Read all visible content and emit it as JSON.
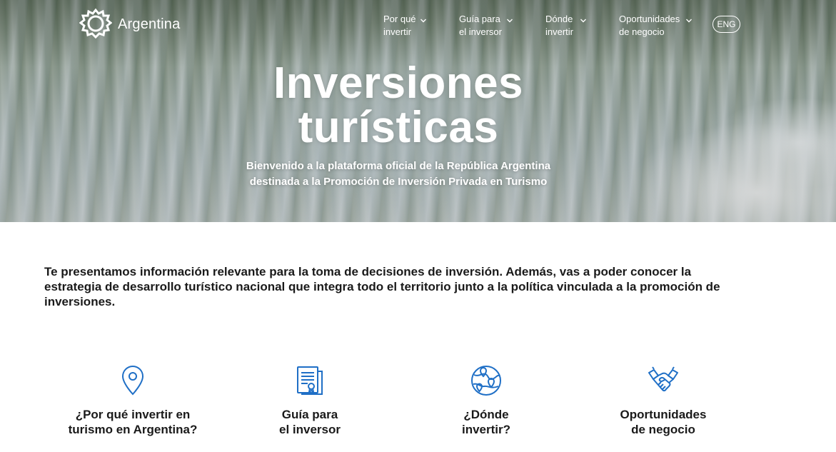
{
  "header": {
    "logo_text": "Argentina",
    "logo_icon": "sun-emblem-icon",
    "nav": [
      {
        "line1": "Por qué",
        "line2": "invertir"
      },
      {
        "line1": "Guía para",
        "line2": "el inversor"
      },
      {
        "line1": "Dónde",
        "line2": "invertir"
      },
      {
        "line1": "Oportunidades",
        "line2": "de negocio"
      }
    ],
    "lang_label": "ENG"
  },
  "hero": {
    "title_line1": "Inversiones",
    "title_line2": "turísticas",
    "subtitle_line1": "Bienvenido a la plataforma oficial de la República Argentina",
    "subtitle_line2": "destinada a la Promoción de Inversión Privada en Turismo"
  },
  "intro": {
    "text": "Te presentamos información relevante para la toma de decisiones de inversión. Además, vas a poder conocer la estrategia de desarrollo turístico nacional que integra todo el territorio junto a la política vinculada a la promoción de inversiones."
  },
  "cards": [
    {
      "icon": "map-pin-icon",
      "line1": "¿Por qué invertir en",
      "line2": "turismo en Argentina?"
    },
    {
      "icon": "document-icon",
      "line1": "Guía para",
      "line2": "el inversor"
    },
    {
      "icon": "globe-pins-icon",
      "line1": "¿Dónde",
      "line2": "invertir?"
    },
    {
      "icon": "handshake-icon",
      "line1": "Oportunidades",
      "line2": "de negocio"
    }
  ],
  "colors": {
    "accent": "#1f6fc6",
    "text": "#1a1a1a",
    "white": "#ffffff"
  }
}
